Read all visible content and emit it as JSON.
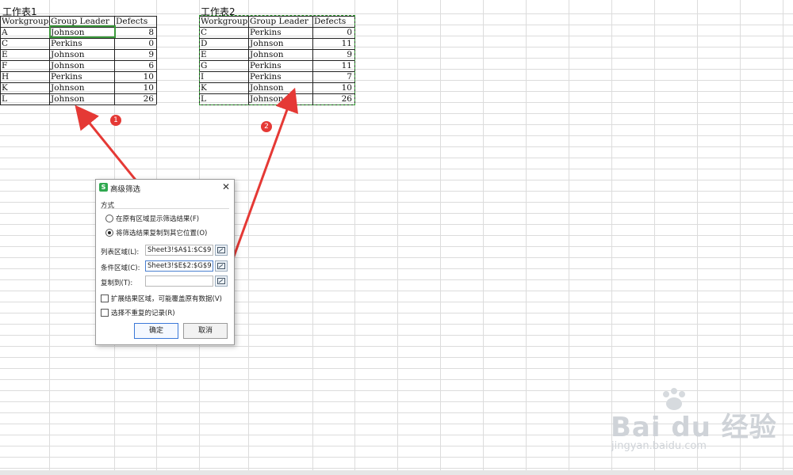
{
  "sheet1": {
    "title": "工作表1",
    "headers": [
      "Workgroup",
      "Group Leader",
      "Defects"
    ],
    "rows": [
      [
        "A",
        "Johnson",
        "8"
      ],
      [
        "C",
        "Perkins",
        "0"
      ],
      [
        "E",
        "Johnson",
        "9"
      ],
      [
        "F",
        "Johnson",
        "6"
      ],
      [
        "H",
        "Perkins",
        "10"
      ],
      [
        "K",
        "Johnson",
        "10"
      ],
      [
        "L",
        "Johnson",
        "26"
      ]
    ]
  },
  "sheet2": {
    "title": "工作表2",
    "headers": [
      "Workgroup",
      "Group Leader",
      "Defects"
    ],
    "rows": [
      [
        "C",
        "Perkins",
        "0"
      ],
      [
        "D",
        "Johnson",
        "11"
      ],
      [
        "E",
        "Johnson",
        "9"
      ],
      [
        "G",
        "Perkins",
        "11"
      ],
      [
        "I",
        "Perkins",
        "7"
      ],
      [
        "K",
        "Johnson",
        "10"
      ],
      [
        "L",
        "Johnson",
        "26"
      ]
    ]
  },
  "annotations": {
    "badge1": "1",
    "badge2": "2"
  },
  "dialog": {
    "title": "高级筛选",
    "logo": "S",
    "close_label": "✕",
    "section_method": "方式",
    "option_in_place": "在原有区域显示筛选结果(F)",
    "option_copy": "将筛选结果复制到其它位置(O)",
    "list_range_label": "列表区域(L):",
    "list_range_value": "Sheet3!$A$1:$C$9",
    "criteria_range_label": "条件区域(C):",
    "criteria_range_value": "Sheet3!$E$2:$G$9",
    "copy_to_label": "复制到(T):",
    "copy_to_value": "",
    "expand_label": "扩展结果区域，可能覆盖原有数据(V)",
    "unique_label": "选择不重复的记录(R)",
    "ok_label": "确定",
    "cancel_label": "取消",
    "selected_option": "copy"
  },
  "watermark": {
    "text": "Bai du 经验",
    "sub": "jingyan.baidu.com"
  },
  "colors": {
    "selection": "#3c9a3c",
    "arrow": "#e53935",
    "accent": "#3b78d8"
  }
}
